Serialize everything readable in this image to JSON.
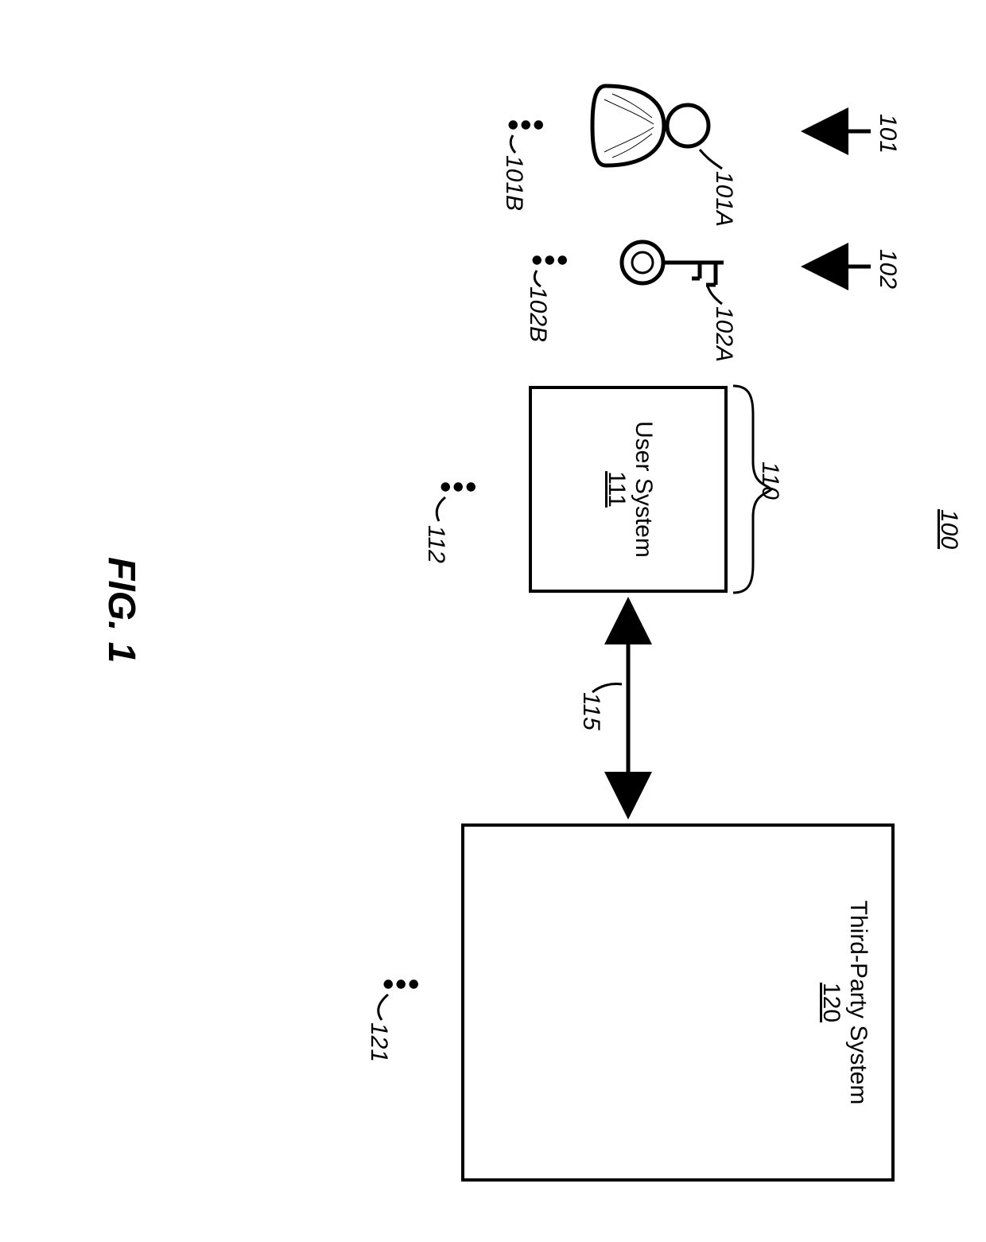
{
  "figure": {
    "overall_ref": "100",
    "caption": "FIG. 1"
  },
  "user_column": {
    "ref_top": "101",
    "ref_a": "101A",
    "ref_b": "101B"
  },
  "key_column": {
    "ref_top": "102",
    "ref_a": "102A",
    "ref_b": "102B"
  },
  "user_system": {
    "group_ref": "110",
    "title": "User System",
    "id": "111",
    "more_ref": "112"
  },
  "link": {
    "ref": "115"
  },
  "third_party": {
    "title": "Third-Party System",
    "id": "120",
    "more_ref": "121"
  }
}
